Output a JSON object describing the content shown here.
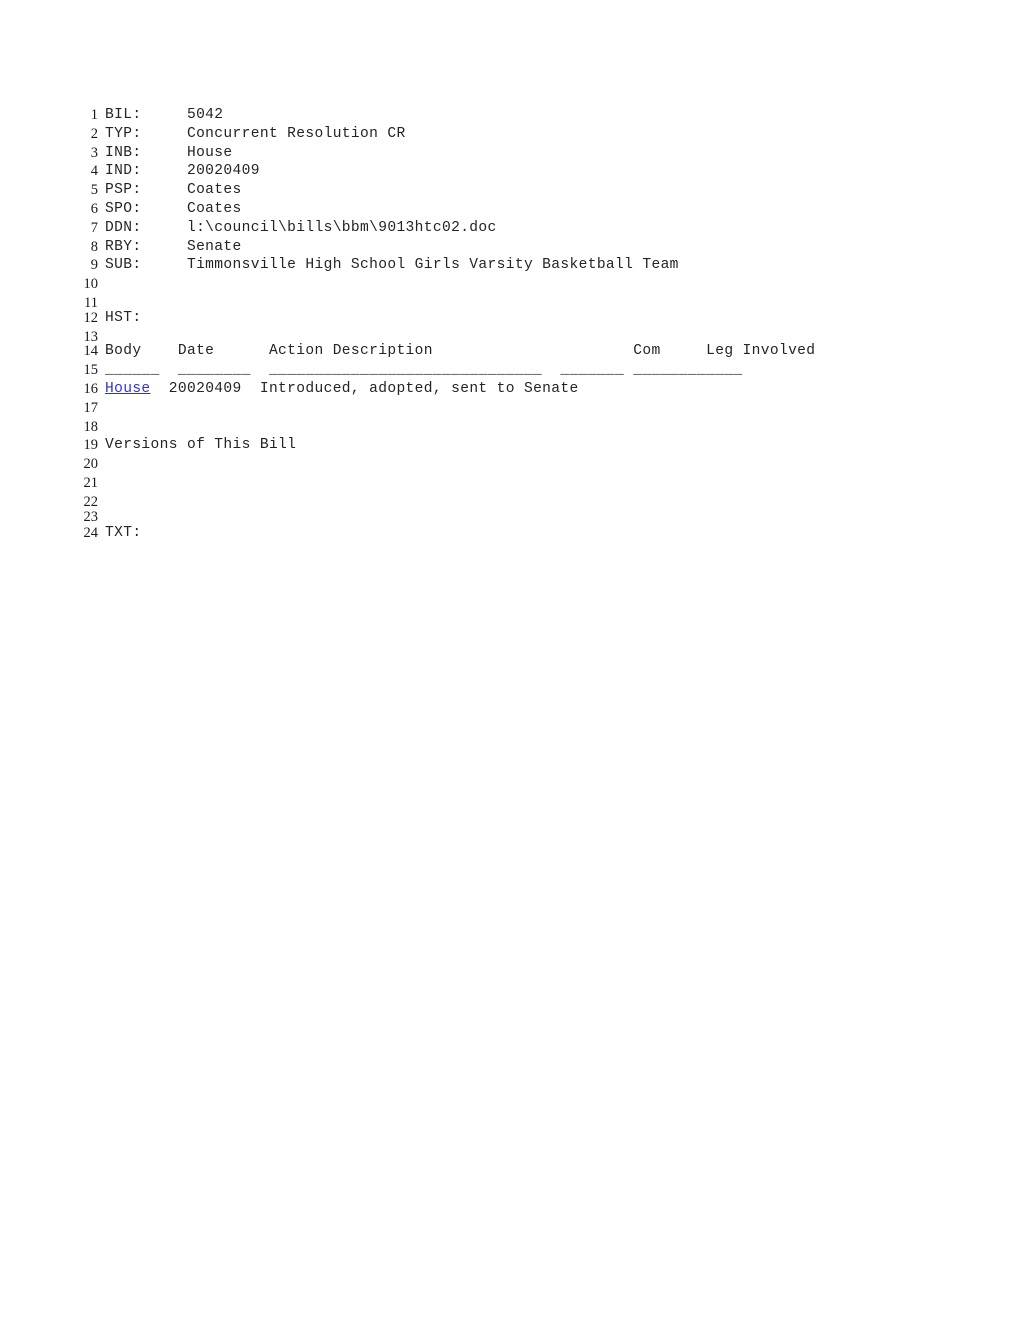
{
  "document": {
    "type": "legislative-bill-text",
    "background_color": "#ffffff",
    "text_color": "#242424",
    "linenumber_color": "#1a1a1a",
    "link_color": "#3333cc",
    "total_lines": 24
  },
  "fields": {
    "bil_label": "BIL:",
    "bil_value": "5042",
    "typ_label": "TYP:",
    "typ_value": "Concurrent Resolution CR",
    "inb_label": "INB:",
    "inb_value": "House",
    "ind_label": "IND:",
    "ind_value": "20020409",
    "psp_label": "PSP:",
    "psp_value": "Coates",
    "spo_label": "SPO:",
    "spo_value": "Coates",
    "ddn_label": "DDN:",
    "ddn_value": "l:\\council\\bills\\bbm\\9013htc02.doc",
    "rby_label": "RBY:",
    "rby_value": "Senate",
    "sub_label": "SUB:",
    "sub_value": "Timmonsville High School Girls Varsity Basketball Team",
    "hst_label": "HST:",
    "txt_label": "TXT:"
  },
  "history_table": {
    "headers": {
      "body": "Body",
      "date": "Date",
      "action": "Action Description",
      "com": "Com",
      "leg": "Leg Involved"
    },
    "rules": {
      "body": "______",
      "date": "________",
      "action": "______________________________",
      "com": "_______",
      "leg": "____________"
    },
    "rows": [
      {
        "body": "House",
        "body_is_link": true,
        "date": "20020409",
        "action": "Introduced, adopted, sent to Senate",
        "com": "",
        "leg": ""
      }
    ]
  },
  "versions_heading": "Versions of This Bill",
  "lines": [
    {
      "n": "1",
      "text": "BIL:     5042"
    },
    {
      "n": "2",
      "text": "TYP:     Concurrent Resolution CR"
    },
    {
      "n": "3",
      "text": "INB:     House"
    },
    {
      "n": "4",
      "text": "IND:     20020409"
    },
    {
      "n": "5",
      "text": "PSP:     Coates"
    },
    {
      "n": "6",
      "text": "SPO:     Coates"
    },
    {
      "n": "7",
      "text": "DDN:     l:\\council\\bills\\bbm\\9013htc02.doc"
    },
    {
      "n": "8",
      "text": "RBY:     Senate"
    },
    {
      "n": "9",
      "text": "SUB:     Timmonsville High School Girls Varsity Basketball Team"
    },
    {
      "n": "10",
      "text": ""
    },
    {
      "n": "11",
      "text": ""
    },
    {
      "n": "12",
      "text": "HST:"
    },
    {
      "n": "13",
      "text": ""
    },
    {
      "n": "14",
      "text": "Body    Date      Action Description                      Com     Leg Involved"
    },
    {
      "n": "15",
      "text": "______  ________  ______________________________  _______ ____________"
    },
    {
      "n": "16",
      "text": ""
    },
    {
      "n": "17",
      "text": ""
    },
    {
      "n": "18",
      "text": ""
    },
    {
      "n": "19",
      "text": "Versions of This Bill"
    },
    {
      "n": "20",
      "text": ""
    },
    {
      "n": "21",
      "text": ""
    },
    {
      "n": "22",
      "text": ""
    },
    {
      "n": "23",
      "text": ""
    },
    {
      "n": "24",
      "text": "TXT:"
    }
  ],
  "line16": {
    "link_text": "House",
    "after_link": "  20020409  Introduced, adopted, sent to Senate"
  }
}
